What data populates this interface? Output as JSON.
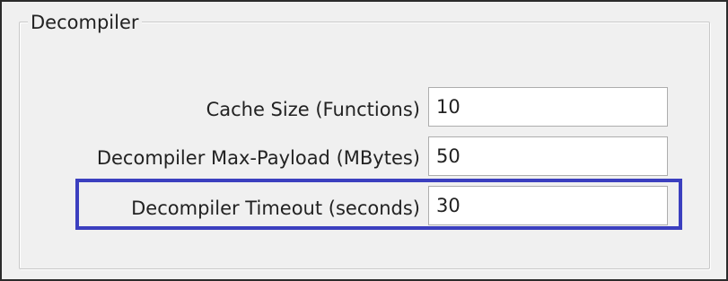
{
  "group": {
    "title": "Decompiler"
  },
  "fields": [
    {
      "label": "Cache Size (Functions)",
      "value": "10"
    },
    {
      "label": "Decompiler Max-Payload (MBytes)",
      "value": "50"
    },
    {
      "label": "Decompiler Timeout (seconds)",
      "value": "30"
    }
  ],
  "colors": {
    "highlight_border": "#3b3fbf",
    "panel_background": "#f0f0f0"
  }
}
